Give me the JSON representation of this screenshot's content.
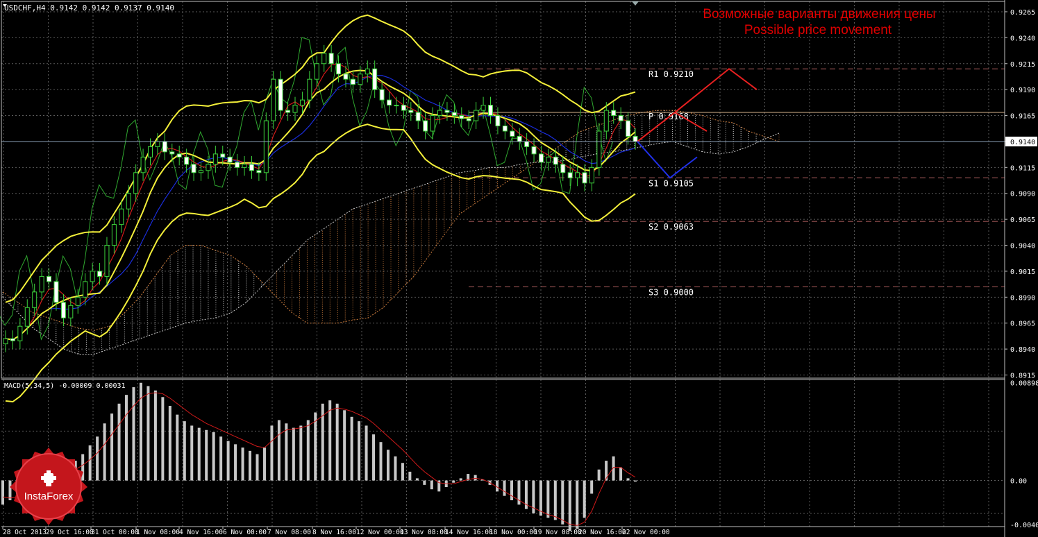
{
  "header": {
    "symbol_line": "USDCHF,H4  0.9142 0.9142 0.9137 0.9140",
    "macd_line": "MACD(5,34,5) -0.00009 0.00031"
  },
  "annotation": {
    "ru": "Возможные варианты движения цены",
    "en": "Possible price movement",
    "color": "#e00000"
  },
  "logo": {
    "text": "InstaForex",
    "color": "#c4161c"
  },
  "chart_data": {
    "type": "candlestick",
    "price_axis": {
      "ticks": [
        "0.9265",
        "0.9240",
        "0.9215",
        "0.9190",
        "0.9165",
        "0.9140",
        "0.9115",
        "0.9090",
        "0.9065",
        "0.9040",
        "0.9015",
        "0.8990",
        "0.8965",
        "0.8940",
        "0.8915"
      ],
      "current": "0.9140",
      "ylim": [
        0.8912,
        0.9275
      ]
    },
    "macd_axis": {
      "ticks": [
        "0.00898",
        "0.00",
        "-0.00409"
      ],
      "ylim": [
        -0.0042,
        0.0092
      ]
    },
    "time_labels": [
      "28 Oct 2013",
      "29 Oct 16:00",
      "31 Oct 00:00",
      "1 Nov 08:00",
      "4 Nov 16:00",
      "6 Nov 00:00",
      "7 Nov 08:00",
      "8 Nov 16:00",
      "12 Nov 00:00",
      "13 Nov 08:00",
      "14 Nov 16:00",
      "18 Nov 00:00",
      "19 Nov 08:00",
      "20 Nov 16:00",
      "22 Nov 00:00"
    ],
    "pivot_levels": [
      {
        "name": "R1",
        "label": "R1  0.9210",
        "value": 0.921
      },
      {
        "name": "P",
        "label": "P  0.9168",
        "value": 0.9168
      },
      {
        "name": "S1",
        "label": "S1  0.9105",
        "value": 0.9105
      },
      {
        "name": "S2",
        "label": "S2  0.9063",
        "value": 0.9063
      },
      {
        "name": "S3",
        "label": "S3  0.9000",
        "value": 0.9
      }
    ],
    "close_series": [
      0.895,
      0.8948,
      0.8962,
      0.898,
      0.8995,
      0.901,
      0.9005,
      0.8985,
      0.897,
      0.8982,
      0.899,
      0.9005,
      0.9015,
      0.901,
      0.904,
      0.906,
      0.9075,
      0.909,
      0.911,
      0.9125,
      0.9135,
      0.914,
      0.913,
      0.9128,
      0.9125,
      0.9118,
      0.911,
      0.9112,
      0.9118,
      0.9128,
      0.9125,
      0.912,
      0.9115,
      0.9118,
      0.9112,
      0.911,
      0.916,
      0.92,
      0.917,
      0.9168,
      0.9175,
      0.918,
      0.92,
      0.9215,
      0.9225,
      0.9215,
      0.9205,
      0.92,
      0.9195,
      0.9205,
      0.921,
      0.919,
      0.918,
      0.9175,
      0.9175,
      0.917,
      0.9168,
      0.916,
      0.915,
      0.9165,
      0.917,
      0.9168,
      0.9165,
      0.9162,
      0.916,
      0.917,
      0.9175,
      0.9165,
      0.9155,
      0.915,
      0.9145,
      0.914,
      0.9135,
      0.9128,
      0.912,
      0.9125,
      0.9118,
      0.911,
      0.9105,
      0.911,
      0.91,
      0.9115,
      0.915,
      0.917,
      0.9165,
      0.916,
      0.9145,
      0.914
    ],
    "macd_hist": [
      -0.0022,
      -0.0018,
      -0.0012,
      -0.0006,
      0.0,
      0.0004,
      0.0006,
      0.0008,
      0.0009,
      0.0012,
      0.0018,
      0.0024,
      0.0032,
      0.004,
      0.0052,
      0.0061,
      0.007,
      0.0078,
      0.0085,
      0.0089,
      0.0086,
      0.0082,
      0.0076,
      0.0068,
      0.006,
      0.0054,
      0.005,
      0.0048,
      0.0046,
      0.0044,
      0.004,
      0.0036,
      0.0033,
      0.003,
      0.0027,
      0.0024,
      0.003,
      0.005,
      0.0055,
      0.0052,
      0.0048,
      0.005,
      0.0055,
      0.0062,
      0.007,
      0.0073,
      0.007,
      0.0064,
      0.0058,
      0.0054,
      0.005,
      0.0042,
      0.0035,
      0.0028,
      0.0022,
      0.0016,
      0.0008,
      0.0002,
      -0.0004,
      -0.0008,
      -0.001,
      -0.0006,
      -0.0002,
      0.0002,
      0.0006,
      0.0005,
      0.0001,
      -0.0004,
      -0.001,
      -0.0014,
      -0.0018,
      -0.0022,
      -0.0026,
      -0.003,
      -0.0032,
      -0.0034,
      -0.0036,
      -0.004,
      -0.0046,
      -0.0044,
      -0.0034,
      -0.0012,
      0.001,
      0.0018,
      0.0022,
      0.0012,
      0.0002,
      -0.0001
    ],
    "macd_signal": [
      -0.0015,
      -0.0016,
      -0.0015,
      -0.0012,
      -0.0008,
      -0.0004,
      0.0,
      0.0003,
      0.0005,
      0.0007,
      0.001,
      0.0014,
      0.0019,
      0.0025,
      0.0033,
      0.0042,
      0.0051,
      0.006,
      0.0068,
      0.0075,
      0.0079,
      0.008,
      0.0079,
      0.0075,
      0.007,
      0.0065,
      0.006,
      0.0056,
      0.0052,
      0.0049,
      0.0046,
      0.0043,
      0.004,
      0.0037,
      0.0034,
      0.0031,
      0.003,
      0.0036,
      0.0042,
      0.0046,
      0.0047,
      0.0048,
      0.005,
      0.0054,
      0.0059,
      0.0064,
      0.0066,
      0.0065,
      0.0063,
      0.006,
      0.0057,
      0.0052,
      0.0046,
      0.004,
      0.0034,
      0.0028,
      0.0021,
      0.0014,
      0.0008,
      0.0003,
      -0.0002,
      -0.0003,
      -0.0003,
      -0.0001,
      0.0001,
      0.0002,
      0.0001,
      -0.0002,
      -0.0006,
      -0.001,
      -0.0014,
      -0.0018,
      -0.0022,
      -0.0025,
      -0.0028,
      -0.0031,
      -0.0033,
      -0.0036,
      -0.004,
      -0.0041,
      -0.0038,
      -0.0028,
      -0.0012,
      0.0002,
      0.0012,
      0.0012,
      0.0007,
      0.0003
    ],
    "forecast": {
      "bullish": [
        0.914,
        0.9168,
        0.921,
        0.919
      ],
      "bearish": [
        0.914,
        0.9105,
        0.9125
      ],
      "alt_leg": [
        0.9168,
        0.915
      ]
    }
  }
}
